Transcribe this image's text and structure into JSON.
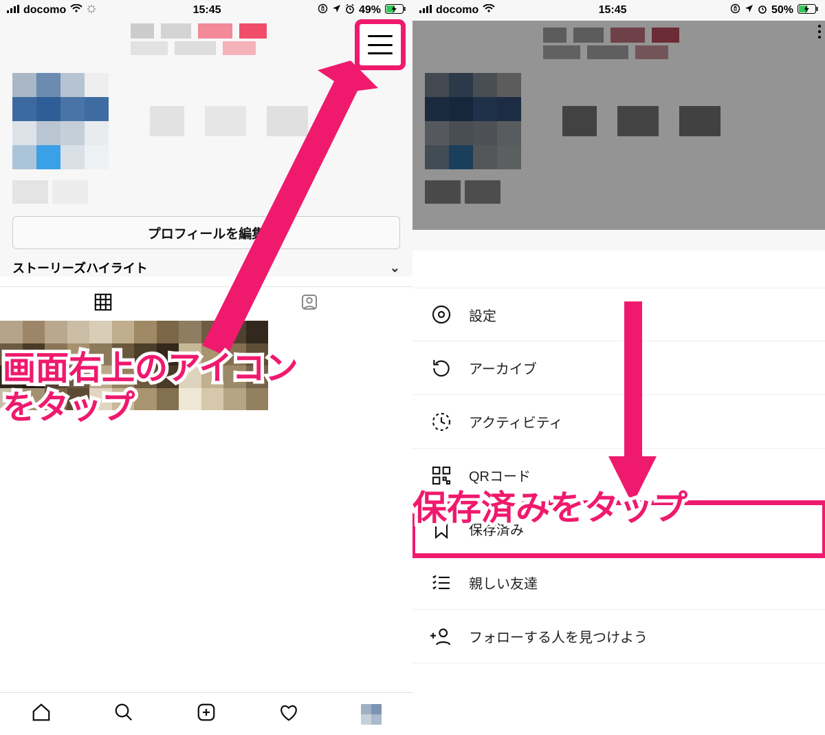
{
  "left": {
    "status": {
      "carrier": "docomo",
      "time": "15:45",
      "battery": "49%"
    },
    "edit_profile_label": "プロフィールを編集",
    "highlight_label": "ストーリーズハイライト",
    "annotation_line1": "画面右上のアイコン",
    "annotation_line2": "をタップ",
    "highlight_color": "#ef1a6d"
  },
  "right": {
    "status": {
      "carrier": "docomo",
      "time": "15:45",
      "battery": "50%"
    },
    "annotation": "保存済みをタップ",
    "menu": [
      {
        "label": "設定",
        "icon": "gear"
      },
      {
        "label": "アーカイブ",
        "icon": "archive"
      },
      {
        "label": "アクティビティ",
        "icon": "activity"
      },
      {
        "label": "QRコード",
        "icon": "qrcode"
      },
      {
        "label": "保存済み",
        "icon": "bookmark",
        "highlighted": true
      },
      {
        "label": "親しい友達",
        "icon": "close-friends"
      },
      {
        "label": "フォローする人を見つけよう",
        "icon": "add-person"
      }
    ]
  }
}
